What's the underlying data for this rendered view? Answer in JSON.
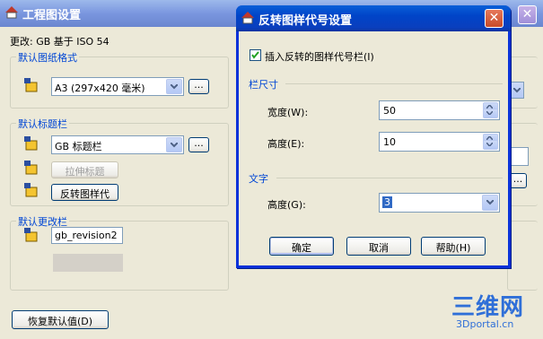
{
  "colors": {
    "xp_blue": "#0044c8",
    "group_label": "#0046d5",
    "watermark": "#2f6fd8"
  },
  "bg_window": {
    "title": "工程图设置",
    "change_label": "更改: GB 基于 ISO 54",
    "paper_group": {
      "label": "默认图纸格式",
      "value": "A3 (297x420 毫米)",
      "more": "..."
    },
    "title_group": {
      "label": "默认标题栏",
      "value": "GB 标题栏",
      "more": "...",
      "stretch_button": "拉伸标题",
      "flip_button": "反转图样代"
    },
    "revision_group": {
      "label": "默认更改栏",
      "value": "gb_revision2"
    },
    "restore_button": "恢复默认值(D)",
    "right_more": "..."
  },
  "dialog": {
    "title": "反转图样代号设置",
    "checkbox_label": "插入反转的图样代号栏(I)",
    "checkbox_checked": true,
    "size_section": "栏尺寸",
    "width_label": "宽度(W):",
    "width_value": "50",
    "height_label": "高度(E):",
    "height_value": "10",
    "text_section": "文字",
    "text_height_label": "高度(G):",
    "text_height_value": "3",
    "ok": "确定",
    "cancel": "取消",
    "help": "帮助(H)"
  },
  "watermark": {
    "main": "三维网",
    "sub": "3Dportal.cn"
  }
}
